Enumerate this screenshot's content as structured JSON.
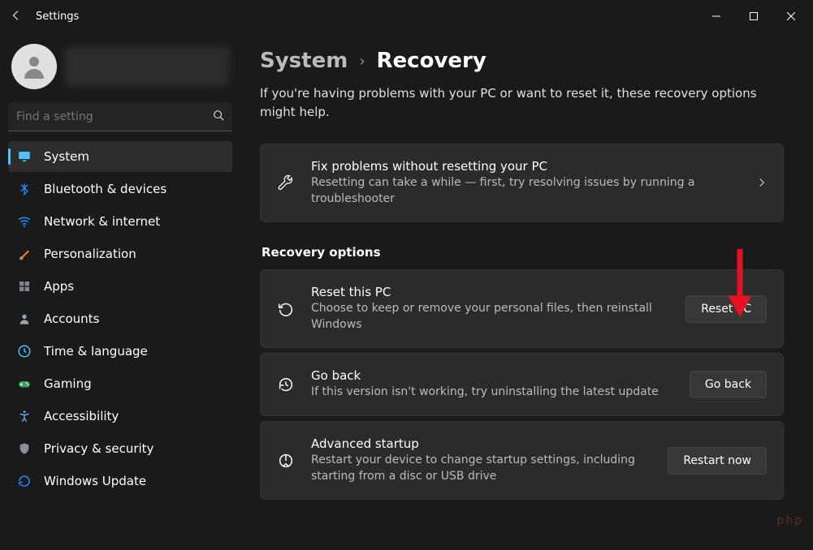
{
  "window": {
    "title": "Settings"
  },
  "search": {
    "placeholder": "Find a setting"
  },
  "nav": {
    "items": [
      {
        "label": "System",
        "active": true,
        "icon": "monitor"
      },
      {
        "label": "Bluetooth & devices",
        "active": false,
        "icon": "bluetooth"
      },
      {
        "label": "Network & internet",
        "active": false,
        "icon": "wifi"
      },
      {
        "label": "Personalization",
        "active": false,
        "icon": "brush"
      },
      {
        "label": "Apps",
        "active": false,
        "icon": "apps"
      },
      {
        "label": "Accounts",
        "active": false,
        "icon": "person"
      },
      {
        "label": "Time & language",
        "active": false,
        "icon": "clock"
      },
      {
        "label": "Gaming",
        "active": false,
        "icon": "gamepad"
      },
      {
        "label": "Accessibility",
        "active": false,
        "icon": "accessibility"
      },
      {
        "label": "Privacy & security",
        "active": false,
        "icon": "shield"
      },
      {
        "label": "Windows Update",
        "active": false,
        "icon": "update"
      }
    ]
  },
  "breadcrumb": {
    "parent": "System",
    "current": "Recovery"
  },
  "lede": "If you're having problems with your PC or want to reset it, these recovery options might help.",
  "fixcard": {
    "title": "Fix problems without resetting your PC",
    "desc": "Resetting can take a while — first, try resolving issues by running a troubleshooter"
  },
  "section": "Recovery options",
  "reset": {
    "title": "Reset this PC",
    "desc": "Choose to keep or remove your personal files, then reinstall Windows",
    "button": "Reset PC"
  },
  "goback": {
    "title": "Go back",
    "desc": "If this version isn't working, try uninstalling the latest update",
    "button": "Go back"
  },
  "advanced": {
    "title": "Advanced startup",
    "desc": "Restart your device to change startup settings, including starting from a disc or USB drive",
    "button": "Restart now"
  },
  "watermark": "php"
}
